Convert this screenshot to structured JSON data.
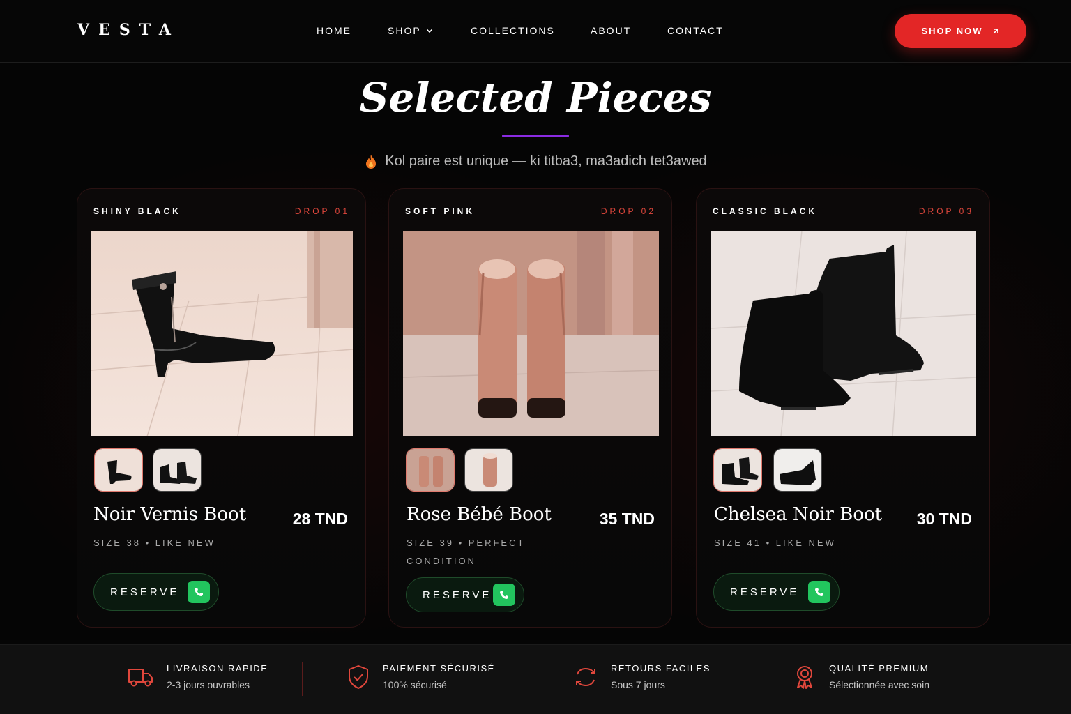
{
  "brand": "VESTA",
  "nav": {
    "links": [
      "HOME",
      "SHOP",
      "COLLECTIONS",
      "ABOUT",
      "CONTACT"
    ],
    "cta": "SHOP NOW"
  },
  "header": {
    "title": "Selected Pieces",
    "subtitle": "Kol paire est unique — ki titba3, ma3adich tet3awed"
  },
  "products": [
    {
      "label": "SHINY BLACK",
      "drop": "DROP 01",
      "name": "Noir Vernis Boot",
      "price": "28 TND",
      "meta": "SIZE 38 • LIKE NEW",
      "reserve": "RESERVE"
    },
    {
      "label": "SOFT PINK",
      "drop": "DROP 02",
      "name": "Rose Bébé Boot",
      "price": "35 TND",
      "meta": "SIZE 39 • PERFECT CONDITION",
      "reserve": "RESERVE"
    },
    {
      "label": "CLASSIC BLACK",
      "drop": "DROP 03",
      "name": "Chelsea Noir Boot",
      "price": "30 TND",
      "meta": "SIZE 41 • LIKE NEW",
      "reserve": "RESERVE"
    }
  ],
  "features": [
    {
      "icon": "truck-icon",
      "title": "LIVRAISON RAPIDE",
      "subtitle": "2-3 jours ouvrables"
    },
    {
      "icon": "shield-check-icon",
      "title": "PAIEMENT SÉCURISÉ",
      "subtitle": "100% sécurisé"
    },
    {
      "icon": "refresh-icon",
      "title": "RETOURS FACILES",
      "subtitle": "Sous 7 jours"
    },
    {
      "icon": "award-icon",
      "title": "QUALITÉ PREMIUM",
      "subtitle": "Sélectionnée avec soin"
    }
  ],
  "colors": {
    "accent": "#e32626",
    "underline": "#8a2be2",
    "drop": "#e0473c",
    "whatsapp": "#22c55e"
  }
}
